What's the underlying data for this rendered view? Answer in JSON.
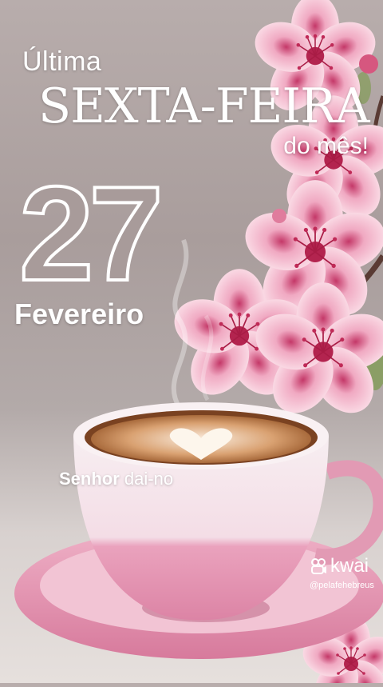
{
  "headline": {
    "line1": "Última",
    "line2": "SEXTA-FEIRA",
    "line3": "do mês!"
  },
  "date": {
    "day": "27",
    "month": "Fevereiro"
  },
  "prayer": {
    "bold": "Senhor",
    "rest": " dai-no"
  },
  "watermark": {
    "brand": "kwai",
    "handle": "@pelafehebreus",
    "icon": "kwai-logo-icon"
  },
  "colors": {
    "background": "#ada2a1",
    "blossom": "#e46f93",
    "cup": "#f5e6ec",
    "saucer": "#e89bb5",
    "coffee": "#c98a4b"
  }
}
